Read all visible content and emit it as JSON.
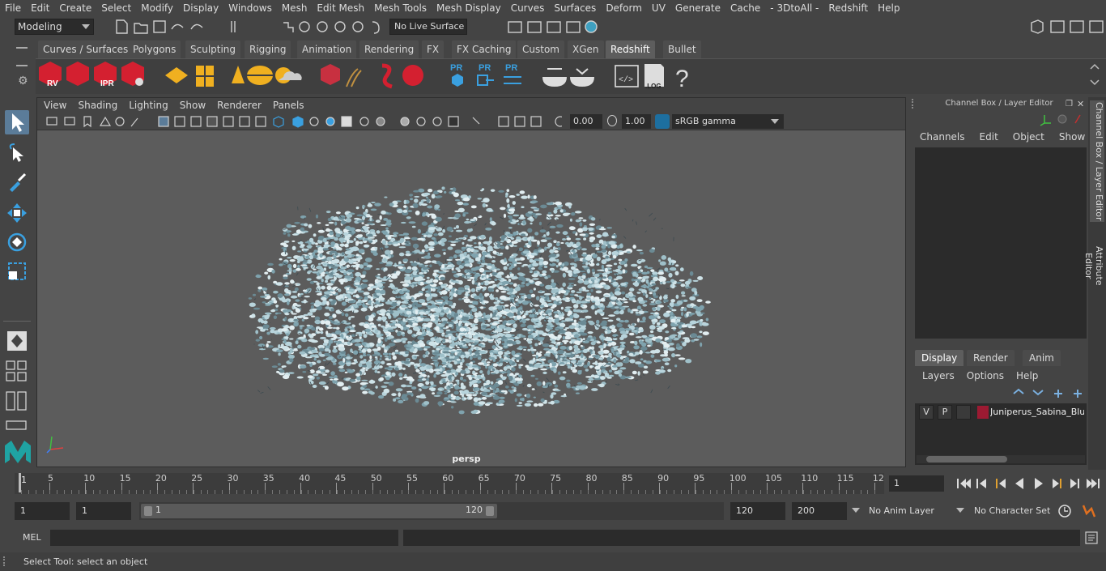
{
  "menubar": {
    "items": [
      "File",
      "Edit",
      "Create",
      "Select",
      "Modify",
      "Display",
      "Windows",
      "Mesh",
      "Edit Mesh",
      "Mesh Tools",
      "Mesh Display",
      "Curves",
      "Surfaces",
      "Deform",
      "UV",
      "Generate",
      "Cache",
      "- 3DtoAll -",
      "Redshift",
      "Help"
    ]
  },
  "statusline": {
    "mode": "Modeling",
    "live_surface": "No Live Surface"
  },
  "shelf": {
    "tabs": [
      "Curves / Surfaces",
      "Polygons",
      "Sculpting",
      "Rigging",
      "Animation",
      "Rendering",
      "FX",
      "FX Caching",
      "Custom",
      "XGen",
      "Redshift",
      "Bullet"
    ],
    "active_tab": "Redshift",
    "icons": {
      "rv": "RV",
      "ipr": "IPR",
      "pr1": "PR",
      "pr2": "PR",
      "pr3": "PR",
      "log": ".LOG",
      "help": "?"
    }
  },
  "viewport": {
    "menu": [
      "View",
      "Shading",
      "Lighting",
      "Show",
      "Renderer",
      "Panels"
    ],
    "exposure": "0.00",
    "gamma": "1.00",
    "color_space": "sRGB gamma",
    "camera_label": "persp"
  },
  "channelbox": {
    "title": "Channel Box / Layer Editor",
    "menu": [
      "Channels",
      "Edit",
      "Object",
      "Show"
    ],
    "display_tabs": [
      "Display",
      "Render",
      "Anim"
    ],
    "active_display_tab": "Display",
    "layers_menu": [
      "Layers",
      "Options",
      "Help"
    ],
    "layer": {
      "v": "V",
      "p": "P",
      "name": "Juniperus_Sabina_Blue",
      "color": "#9c1a32"
    }
  },
  "sidetabs": {
    "channel_box": "Channel Box / Layer Editor",
    "attribute_editor": "Attribute Editor"
  },
  "timeslider": {
    "labels": [
      "5",
      "10",
      "15",
      "20",
      "25",
      "30",
      "35",
      "40",
      "45",
      "50",
      "55",
      "60",
      "65",
      "70",
      "75",
      "80",
      "85",
      "90",
      "95",
      "100",
      "105",
      "110",
      "115",
      "12"
    ],
    "start_label": "1",
    "current_frame": "1"
  },
  "rangebar": {
    "start": "1",
    "playback_start": "1",
    "range_start_label": "1",
    "range_end_label": "120",
    "playback_end": "120",
    "end": "200",
    "anim_layer": "No Anim Layer",
    "character_set": "No Character Set"
  },
  "cmdline": {
    "label": "MEL"
  },
  "helpline": {
    "text": "Select Tool: select an object"
  },
  "colors": {
    "accent_blue": "#5b7c99",
    "redshift_red": "#d42030",
    "maya_teal": "#1fa3a3",
    "foliage": "#b8d4dc"
  }
}
